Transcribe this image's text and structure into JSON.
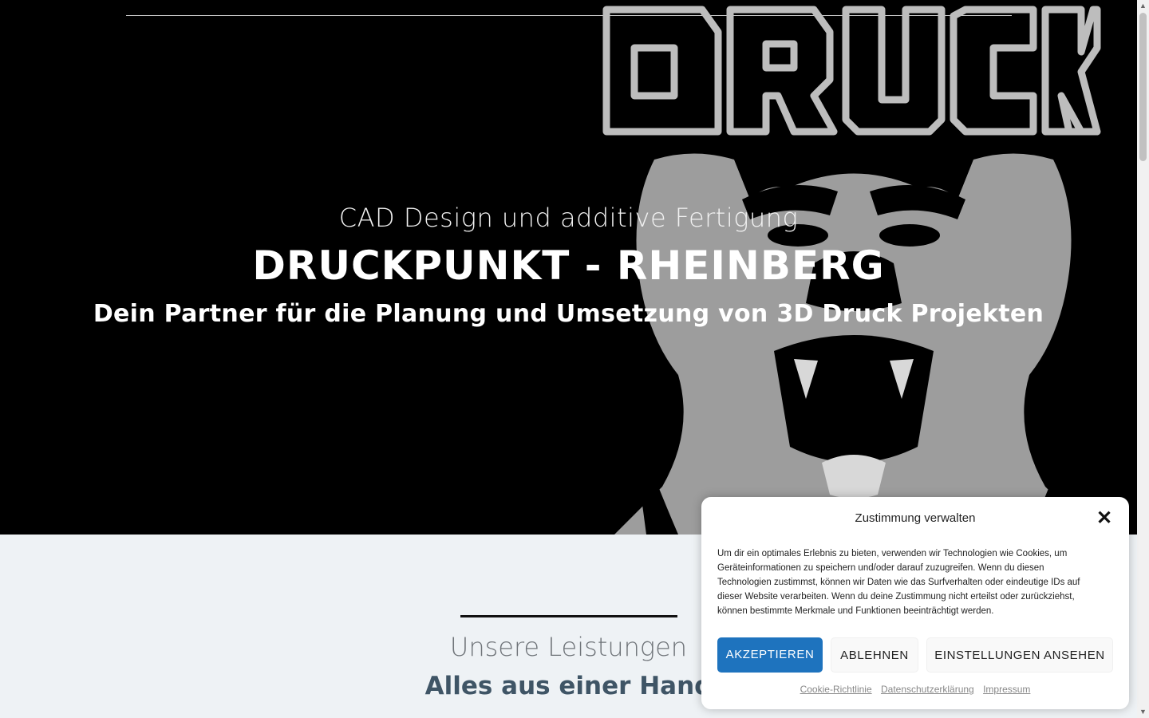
{
  "hero": {
    "kicker": "CAD Design und additive Fertigung",
    "title": "DRUCKPUNKT - RHEINBERG",
    "subtitle": "Dein Partner für die Planung und Umsetzung von 3D Druck Projekten",
    "logo_text": "DRUCK"
  },
  "services": {
    "heading": "Unsere Leistungen",
    "subheading": "Alles aus einer Hand"
  },
  "cookie_banner": {
    "title": "Zustimmung verwalten",
    "close_icon": "close-icon",
    "text": "Um dir ein optimales Erlebnis zu bieten, verwenden wir Technologien wie Cookies, um Geräteinformationen zu speichern und/oder darauf zuzugreifen. Wenn du diesen Technologien zustimmst, können wir Daten wie das Surfverhalten oder eindeutige IDs auf dieser Website verarbeiten. Wenn du deine Zustimmung nicht erteilst oder zurückziehst, können bestimmte Merkmale und Funktionen beeinträchtigt werden.",
    "accept_label": "AKZEPTIEREN",
    "deny_label": "ABLEHNEN",
    "settings_label": "EINSTELLUNGEN ANSEHEN",
    "links": [
      "Cookie-Richtlinie",
      "Datenschutzerklärung",
      "Impressum"
    ]
  },
  "colors": {
    "hero_bg": "#000000",
    "accent": "#1e73be",
    "services_bg": "#eef2f5"
  }
}
